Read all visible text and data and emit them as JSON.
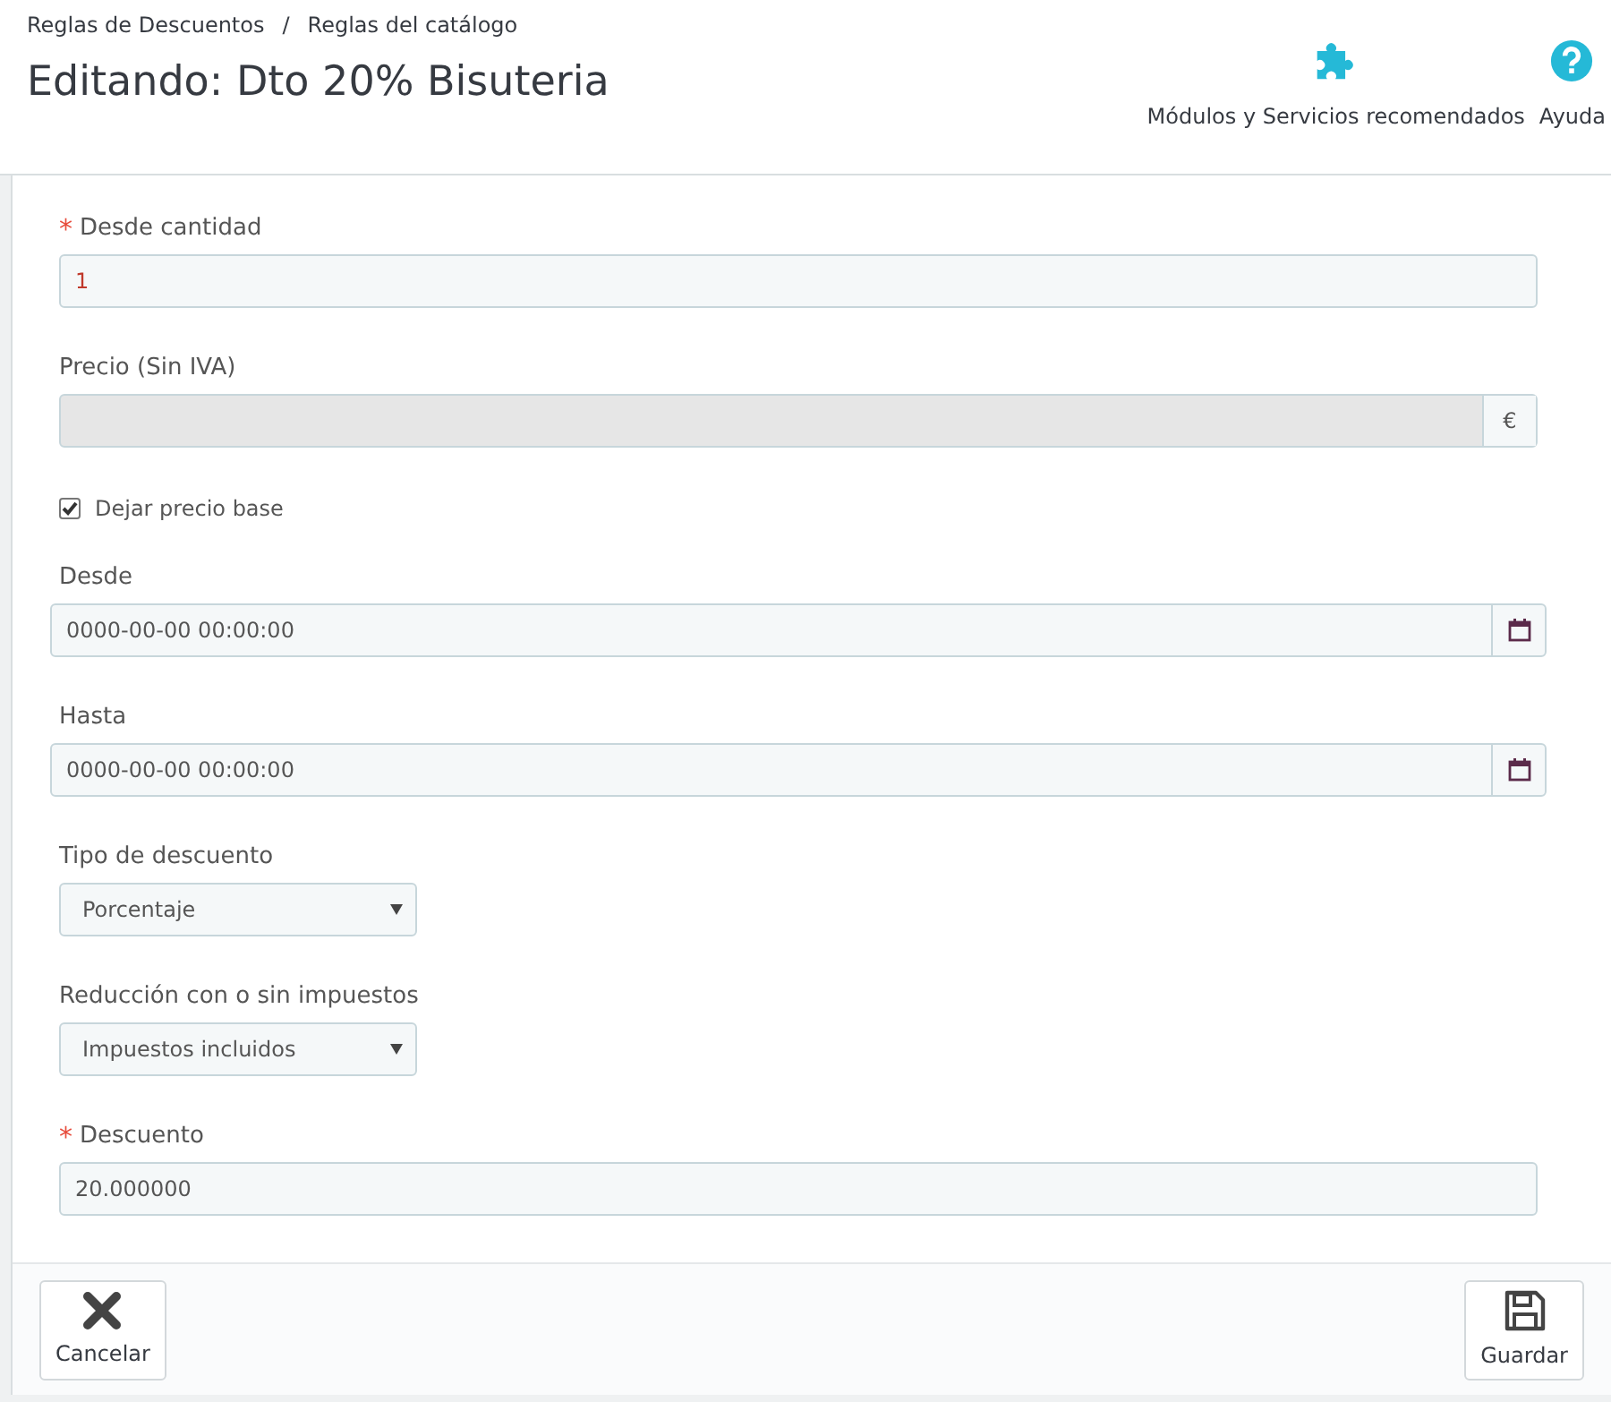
{
  "breadcrumbs": [
    "Reglas de Descuentos",
    "/",
    "Reglas del catálogo"
  ],
  "title": "Editando: Dto 20% Bisuteria",
  "toolbar": [
    {
      "kind": "puzzle",
      "label": "Módulos y Servicios recomendados"
    },
    {
      "kind": "help",
      "label": "Ayuda"
    }
  ],
  "fields": [
    {
      "kind": "text",
      "required_mark": "*",
      "label": "Desde cantidad",
      "value": "1",
      "color": "#c0392b"
    },
    {
      "kind": "addon",
      "label": "Precio (Sin IVA)",
      "disabled": true,
      "addon": "€"
    },
    {
      "kind": "checkbox",
      "label": "Dejar precio base",
      "checked": true
    },
    {
      "kind": "date",
      "label": "Desde",
      "value": "0000-00-00 00:00:00"
    },
    {
      "kind": "date",
      "label": "Hasta",
      "value": "0000-00-00 00:00:00"
    },
    {
      "kind": "select",
      "label": "Tipo de descuento",
      "value": "Porcentaje"
    },
    {
      "kind": "select",
      "label": "Reducción con o sin impuestos",
      "value": "Impuestos incluidos"
    },
    {
      "kind": "text",
      "required_mark": "*",
      "label": "Descuento",
      "value": "20.000000",
      "color": "#555555"
    }
  ],
  "footer": [
    {
      "kind": "cancel",
      "label": "Cancelar"
    },
    {
      "kind": "save",
      "label": "Guardar"
    }
  ]
}
